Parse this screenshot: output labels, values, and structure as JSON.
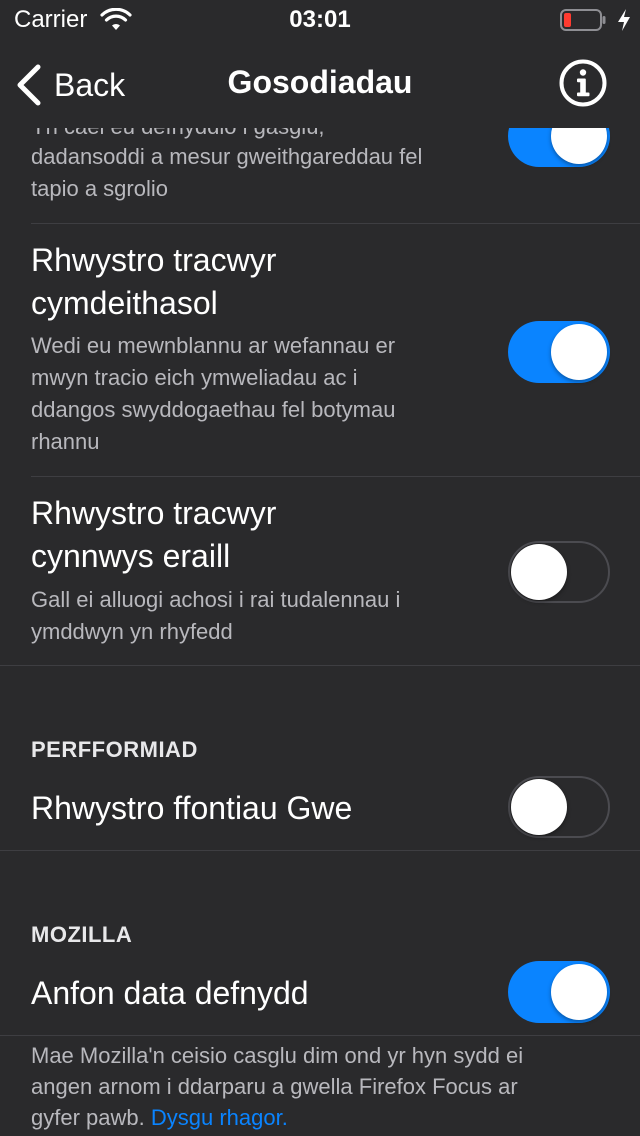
{
  "status_bar": {
    "carrier": "Carrier",
    "time": "03:01"
  },
  "nav": {
    "back_label": "Back",
    "title": "Gosodiadau"
  },
  "tracking": {
    "partial_row": {
      "desc_line0": "Yn cael eu defnyddio i gasglu,",
      "desc_line1": "dadansoddi a mesur gweithgareddau fel",
      "desc_line2": "tapio a sgrolio",
      "toggle": true
    },
    "social_row": {
      "title_line1": "Rhwystro tracwyr",
      "title_line2": "cymdeithasol",
      "desc_line1": "Wedi eu mewnblannu ar wefannau er",
      "desc_line2": "mwyn tracio eich ymweliadau ac i",
      "desc_line3": "ddangos swyddogaethau fel botymau",
      "desc_line4": "rhannu",
      "toggle": true
    },
    "other_row": {
      "title_line1": "Rhwystro tracwyr",
      "title_line2": "cynnwys eraill",
      "desc_line1": "Gall ei alluogi achosi i rai tudalennau i",
      "desc_line2": "ymddwyn yn rhyfedd",
      "toggle": false
    }
  },
  "performance": {
    "header": "PERFFORMIAD",
    "fonts_row": {
      "title": "Rhwystro ffontiau Gwe",
      "toggle": false
    }
  },
  "mozilla": {
    "header": "MOZILLA",
    "data_row": {
      "title": "Anfon data defnydd",
      "toggle": true
    },
    "footer_line1": "Mae Mozilla'n ceisio casglu dim ond yr hyn sydd ei",
    "footer_line2": "angen arnom i ddarparu a gwella Firefox Focus ar",
    "footer_line3_prefix": "gyfer pawb.",
    "footer_link": "Dysgu rhagor."
  },
  "colors": {
    "background": "#2a2a2c",
    "accent": "#0a84ff",
    "battery_low": "#ff3b30"
  },
  "icons": [
    "wifi-icon",
    "battery-icon",
    "charging-icon",
    "chevron-left-icon",
    "info-icon"
  ]
}
